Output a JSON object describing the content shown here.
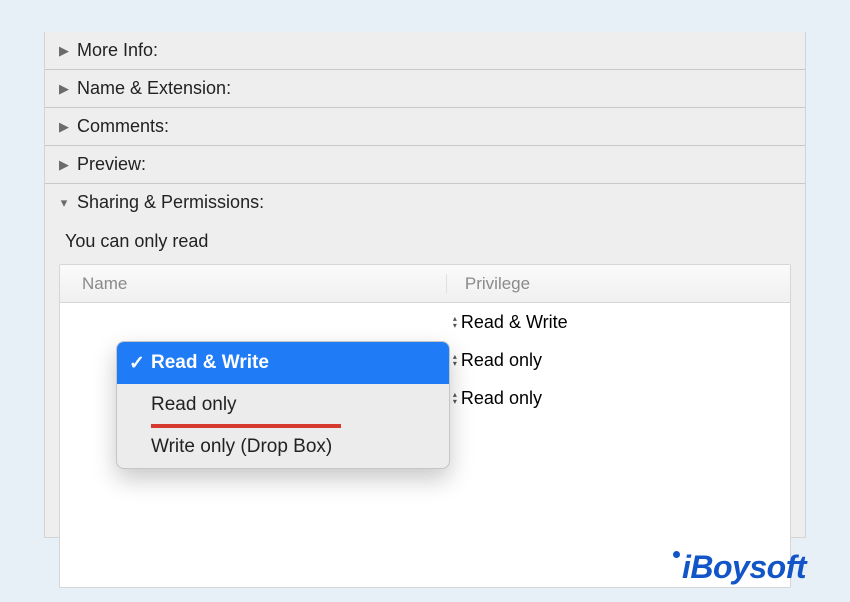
{
  "sections": [
    {
      "label": "More Info:",
      "expanded": false
    },
    {
      "label": "Name & Extension:",
      "expanded": false
    },
    {
      "label": "Comments:",
      "expanded": false
    },
    {
      "label": "Preview:",
      "expanded": false
    },
    {
      "label": "Sharing & Permissions:",
      "expanded": true
    }
  ],
  "sharing": {
    "status": "You can only read",
    "columns": {
      "name": "Name",
      "privilege": "Privilege"
    },
    "rows": [
      {
        "privilege": "Read & Write"
      },
      {
        "privilege": "Read only"
      },
      {
        "privilege": "Read only"
      }
    ]
  },
  "popup": {
    "items": [
      {
        "label": "Read & Write",
        "selected": true
      },
      {
        "label": "Read only",
        "selected": false
      },
      {
        "label": "Write only (Drop Box)",
        "selected": false
      }
    ]
  },
  "brand": "iBoysoft"
}
